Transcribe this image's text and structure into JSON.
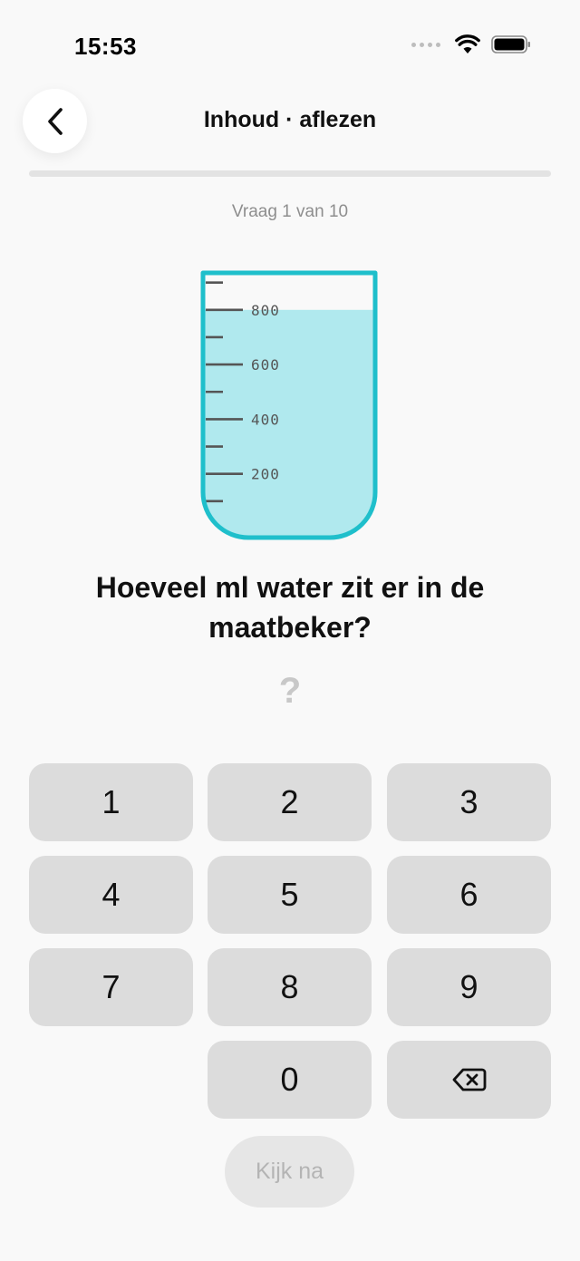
{
  "status_bar": {
    "time": "15:53",
    "icons": [
      "signal-dots-icon",
      "wifi-icon",
      "battery-icon"
    ]
  },
  "nav": {
    "back_icon": "chevron-left-icon",
    "title": "Inhoud · aflezen"
  },
  "progress": {
    "label": "Vraag 1 van 10",
    "fraction": 0,
    "accent": "#24c4cf"
  },
  "beaker": {
    "ticks": [
      "200",
      "400",
      "600",
      "800"
    ],
    "max_ml": 900,
    "fill_ml": 800,
    "outline_color": "#1fbfcb",
    "water_color": "#b0e9ee"
  },
  "question": {
    "text": "Hoeveel ml water zit er in de maatbeker?"
  },
  "answer": {
    "value": "?"
  },
  "keypad": {
    "k1": "1",
    "k2": "2",
    "k3": "3",
    "k4": "4",
    "k5": "5",
    "k6": "6",
    "k7": "7",
    "k8": "8",
    "k9": "9",
    "k0": "0",
    "backspace_icon": "backspace-icon"
  },
  "check_button": {
    "label": "Kijk na"
  }
}
